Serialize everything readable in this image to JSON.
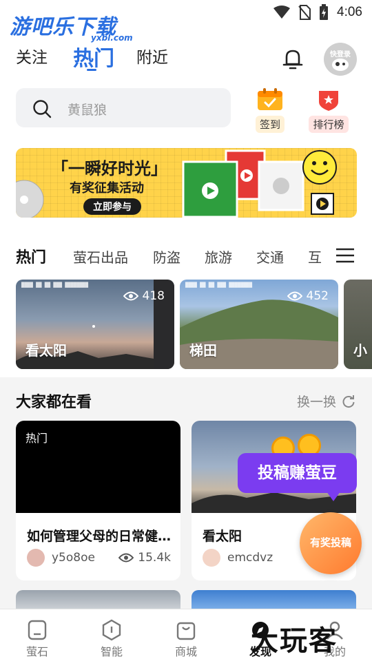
{
  "status_bar": {
    "time": "4:06"
  },
  "watermark_top": {
    "text": "游吧乐下载",
    "sub": "yxbl.com"
  },
  "header": {
    "tabs": [
      {
        "label": "关注"
      },
      {
        "label": "热门",
        "active": true
      },
      {
        "label": "附近"
      }
    ],
    "avatar_label": "快登录"
  },
  "search": {
    "placeholder": "黄鼠狼",
    "quick_actions": [
      {
        "label": "签到",
        "icon": "calendar-check-icon"
      },
      {
        "label": "排行榜",
        "icon": "ranking-shield-icon"
      }
    ]
  },
  "banner": {
    "title": "「一瞬好时光」",
    "subtitle": "有奖征集活动",
    "cta": "立即参与"
  },
  "categories": {
    "items": [
      "热门",
      "萤石出品",
      "防盗",
      "旅游",
      "交通",
      "互"
    ],
    "active_index": 0
  },
  "hot_videos": [
    {
      "title": "看太阳",
      "views": "418"
    },
    {
      "title": "梯田",
      "views": "452"
    },
    {
      "title": "小"
    }
  ],
  "section": {
    "title": "大家都在看",
    "refresh_label": "换一换"
  },
  "feed": [
    {
      "tag": "热门",
      "title": "如何管理父母的日常健…",
      "author": "y5o8oe",
      "views": "15.4k"
    },
    {
      "title": "看太阳",
      "author": "emcdvz"
    }
  ],
  "promo": {
    "label": "投稿赚萤豆"
  },
  "fab": {
    "label": "有奖投稿"
  },
  "tabbar": {
    "items": [
      {
        "label": "萤石",
        "icon": "home-icon"
      },
      {
        "label": "智能",
        "icon": "hexagon-icon"
      },
      {
        "label": "商城",
        "icon": "shopping-bag-icon"
      },
      {
        "label": "发现",
        "icon": "discover-icon",
        "active": true
      },
      {
        "label": "我的",
        "icon": "profile-icon"
      }
    ]
  },
  "watermark_bottom": {
    "text": "大玩客"
  },
  "colors": {
    "accent": "#2a6fe0",
    "promo": "#7b3cf0",
    "fab": "#ff8a3d",
    "banner": "#ffd34a"
  }
}
